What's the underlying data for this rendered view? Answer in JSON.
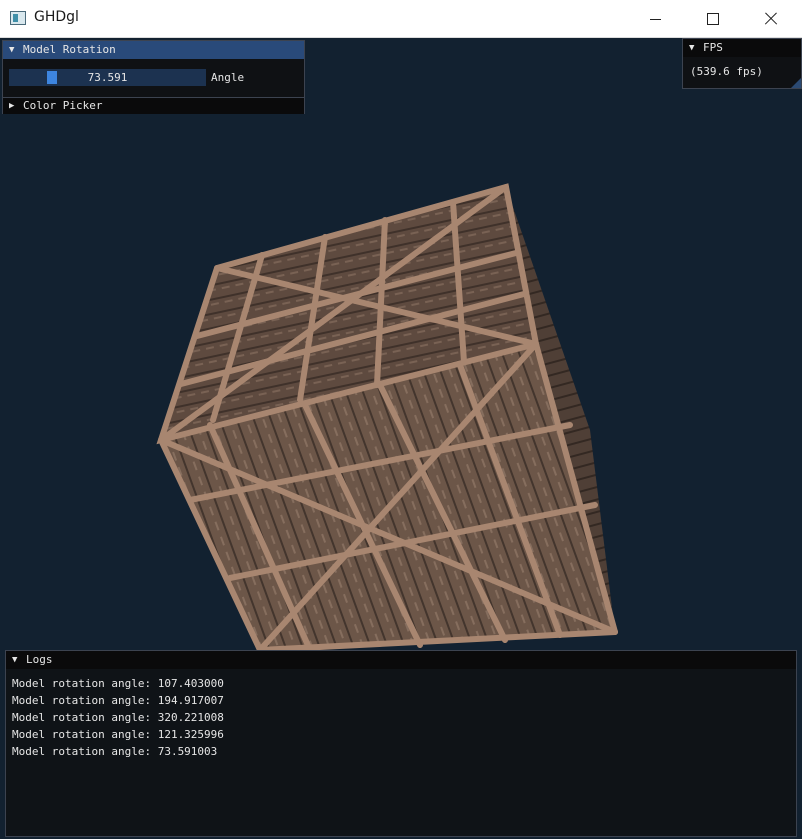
{
  "window": {
    "title": "GHDgl",
    "minimize": "—",
    "maximize": "☐",
    "close": "✕"
  },
  "model_rotation": {
    "title": "Model Rotation",
    "slider_value": "73.591",
    "slider_fraction": 0.2044,
    "slider_label": "Angle"
  },
  "color_picker": {
    "title": "Color Picker"
  },
  "fps": {
    "title": "FPS",
    "value": "(539.6 fps)"
  },
  "logs": {
    "title": "Logs",
    "lines": [
      "Model rotation angle: 107.403000",
      "Model rotation angle: 194.917007",
      "Model rotation angle: 320.221008",
      "Model rotation angle: 121.325996",
      "Model rotation angle: 73.591003"
    ]
  },
  "colors": {
    "background": "#122130",
    "header_active": "#294a7a",
    "slider_grab": "#3d85e0",
    "crate_wood": "#6b5446",
    "crate_beam": "#b08a70"
  }
}
